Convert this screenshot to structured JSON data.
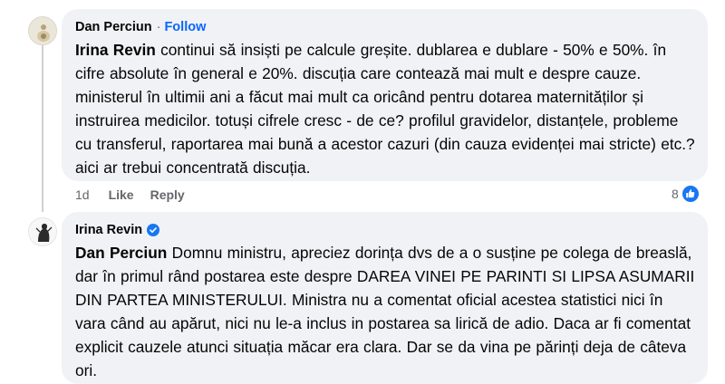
{
  "comment1": {
    "author": "Dan Perciun",
    "separator": "·",
    "follow_label": "Follow",
    "mention": "Irina Revin",
    "text": " continui să insiști pe calcule greșite. dublarea e dublare - 50% e 50%. în cifre absolute în general e 20%. discuția care contează mai mult e despre cauze. ministerul în ultimii ani a făcut mai mult ca oricând pentru dotarea maternităților și instruirea medicilor. totuși cifrele cresc - de ce? profilul gravidelor, distanțele, probleme cu transferul, raportarea mai bună a acestor cazuri (din cauza evidenței mai stricte) etc.? aici ar trebui concentrată discuția.",
    "time": "1d",
    "like_label": "Like",
    "reply_label": "Reply",
    "reaction_count": "8",
    "reaction_icon": "like-icon"
  },
  "comment2": {
    "author": "Irina Revin",
    "verified_icon": "verified-badge-icon",
    "mention": "Dan Perciun",
    "text": " Domnu ministru, apreciez dorința dvs de a o susține pe colega de breaslă, dar în primul rând postarea este despre DAREA VINEI PE PARINTI SI LIPSA ASUMARII DIN PARTEA MINISTERULUI. Ministra nu a comentat oficial acestea statistici nici în vara când au apărut, nici nu le-a inclus in postarea sa lirică de adio. Daca ar fi comentat explicit cauzele atunci situația măcar era clara. Dar se da vina pe părinți deja de câteva ori."
  },
  "colors": {
    "bubble": "#f0f2f5",
    "link_blue": "#0866ff",
    "meta_gray": "#65676b",
    "text": "#050505"
  }
}
